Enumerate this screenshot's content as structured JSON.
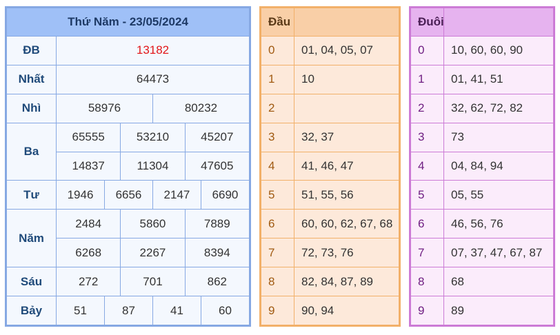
{
  "results": {
    "header": "Thứ Năm - 23/05/2024",
    "rows": [
      {
        "label": "ĐB",
        "values": [
          "13182"
        ]
      },
      {
        "label": "Nhất",
        "values": [
          "64473"
        ]
      },
      {
        "label": "Nhì",
        "values": [
          "58976",
          "80232"
        ]
      },
      {
        "label": "Ba",
        "values": [
          "65555",
          "53210",
          "45207",
          "14837",
          "11304",
          "47605"
        ]
      },
      {
        "label": "Tư",
        "values": [
          "1946",
          "6656",
          "2147",
          "6690"
        ]
      },
      {
        "label": "Năm",
        "values": [
          "2484",
          "5860",
          "7889",
          "6268",
          "2267",
          "8394"
        ]
      },
      {
        "label": "Sáu",
        "values": [
          "272",
          "701",
          "862"
        ]
      },
      {
        "label": "Bảy",
        "values": [
          "51",
          "87",
          "41",
          "60"
        ]
      }
    ],
    "special_color": "#e2171a"
  },
  "dau": {
    "header": "Đầu",
    "rows": [
      {
        "digit": "0",
        "numbers": "01, 04, 05, 07"
      },
      {
        "digit": "1",
        "numbers": "10"
      },
      {
        "digit": "2",
        "numbers": ""
      },
      {
        "digit": "3",
        "numbers": "32, 37"
      },
      {
        "digit": "4",
        "numbers": "41, 46, 47"
      },
      {
        "digit": "5",
        "numbers": "51, 55, 56"
      },
      {
        "digit": "6",
        "numbers": "60, 60, 62, 67, 68"
      },
      {
        "digit": "7",
        "numbers": "72, 73, 76"
      },
      {
        "digit": "8",
        "numbers": "82, 84, 87, 89"
      },
      {
        "digit": "9",
        "numbers": "90, 94"
      }
    ]
  },
  "duoi": {
    "header": "Đuôi",
    "rows": [
      {
        "digit": "0",
        "numbers": "10, 60, 60, 90"
      },
      {
        "digit": "1",
        "numbers": "01, 41, 51"
      },
      {
        "digit": "2",
        "numbers": "32, 62, 72, 82"
      },
      {
        "digit": "3",
        "numbers": "73"
      },
      {
        "digit": "4",
        "numbers": "04, 84, 94"
      },
      {
        "digit": "5",
        "numbers": "05, 55"
      },
      {
        "digit": "6",
        "numbers": "46, 56, 76"
      },
      {
        "digit": "7",
        "numbers": "07, 37, 47, 67, 87"
      },
      {
        "digit": "8",
        "numbers": "68"
      },
      {
        "digit": "9",
        "numbers": "89"
      }
    ]
  }
}
